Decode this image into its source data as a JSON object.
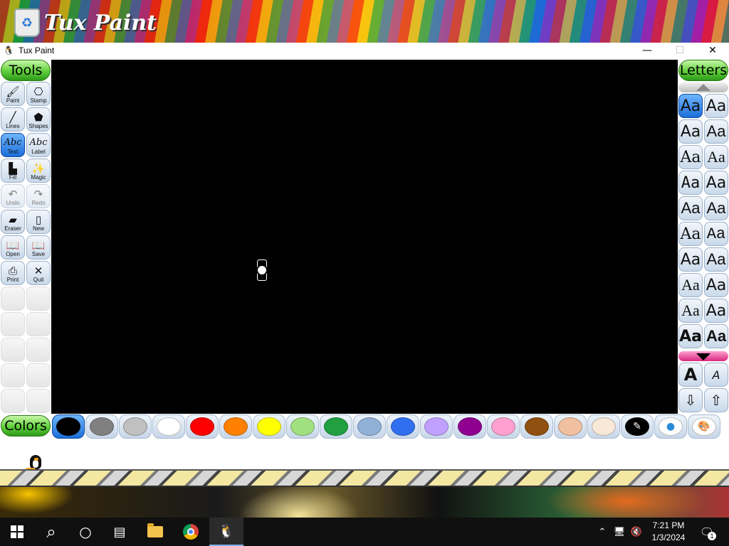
{
  "wallpaper": {
    "logo_text": "Tux Paint"
  },
  "window": {
    "title": "Tux Paint",
    "controls": {
      "minimize": "—",
      "maximize": "☐",
      "close": "✕"
    }
  },
  "tools_panel": {
    "header": "Tools",
    "items": [
      {
        "label": "Paint",
        "glyph": "🖌",
        "state": "normal"
      },
      {
        "label": "Stamp",
        "glyph": "⎔",
        "state": "normal"
      },
      {
        "label": "Lines",
        "glyph": "╱",
        "state": "normal"
      },
      {
        "label": "Shapes",
        "glyph": "⬟",
        "state": "normal"
      },
      {
        "label": "Text",
        "glyph": "Abc",
        "state": "active"
      },
      {
        "label": "Label",
        "glyph": "Abc",
        "state": "normal"
      },
      {
        "label": "Fill",
        "glyph": "▙",
        "state": "normal"
      },
      {
        "label": "Magic",
        "glyph": "✨",
        "state": "normal"
      },
      {
        "label": "Undo",
        "glyph": "↶",
        "state": "disabled"
      },
      {
        "label": "Redo",
        "glyph": "↷",
        "state": "disabled"
      },
      {
        "label": "Eraser",
        "glyph": "▰",
        "state": "normal"
      },
      {
        "label": "New",
        "glyph": "▯",
        "state": "normal"
      },
      {
        "label": "Open",
        "glyph": "📖",
        "state": "normal"
      },
      {
        "label": "Save",
        "glyph": "📖",
        "state": "normal"
      },
      {
        "label": "Print",
        "glyph": "⎙",
        "state": "normal"
      },
      {
        "label": "Quit",
        "glyph": "✕",
        "state": "normal"
      }
    ]
  },
  "letters_panel": {
    "header": "Letters",
    "font_sample": "Aa",
    "font_count": 20,
    "active_index": 0,
    "size_buttons": [
      {
        "name": "bigger-text",
        "glyph": "A"
      },
      {
        "name": "smaller-text",
        "glyph": "A"
      },
      {
        "name": "move-down",
        "glyph": "⇩"
      },
      {
        "name": "move-up",
        "glyph": "⇧"
      }
    ]
  },
  "colors_panel": {
    "header": "Colors",
    "swatches": [
      "#000000",
      "#808080",
      "#c0c0c0",
      "#ffffff",
      "#ff0000",
      "#ff8000",
      "#ffff00",
      "#a0e080",
      "#20a040",
      "#90b0d8",
      "#3070f0",
      "#c0a0ff",
      "#900090",
      "#ffa0d0",
      "#905010",
      "#f0c0a0",
      "#f8e8d8"
    ],
    "active_index": 0
  },
  "taskbar": {
    "items": [
      {
        "name": "start",
        "glyph": ""
      },
      {
        "name": "search",
        "glyph": "⌕"
      },
      {
        "name": "cortana",
        "glyph": "○"
      },
      {
        "name": "task-view",
        "glyph": "▤"
      },
      {
        "name": "file-explorer",
        "glyph": ""
      },
      {
        "name": "chrome",
        "glyph": ""
      },
      {
        "name": "tux-paint",
        "glyph": "🐧"
      }
    ],
    "tray": {
      "chevron": "⌃",
      "network": "🖥",
      "volume": "🔇"
    },
    "time": "7:21 PM",
    "date": "1/3/2024",
    "notification_count": "1"
  }
}
